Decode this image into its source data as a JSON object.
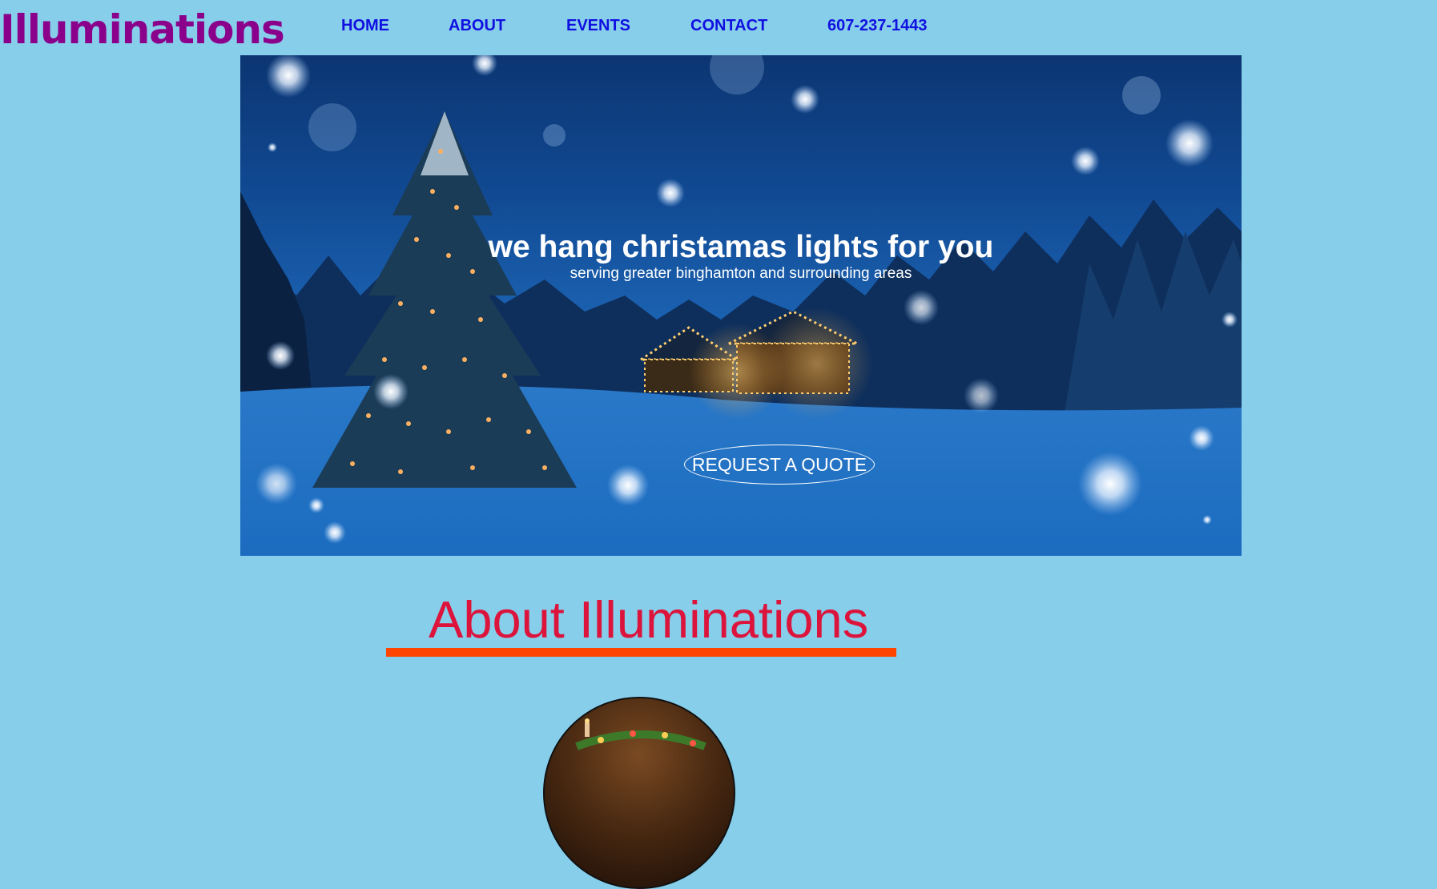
{
  "brand": {
    "logo": "Illuminations"
  },
  "nav": {
    "items": [
      {
        "label": "HOME"
      },
      {
        "label": "ABOUT"
      },
      {
        "label": "EVENTS"
      },
      {
        "label": "CONTACT"
      },
      {
        "label": "607-237-1443"
      }
    ]
  },
  "hero": {
    "title": "we hang christamas lights for you",
    "subtitle": "serving greater binghamton and surrounding areas",
    "cta": "REQUEST A QUOTE"
  },
  "about": {
    "title": "About Illuminations"
  },
  "colors": {
    "background": "#87ceeb",
    "logo": "#8b008b",
    "nav_link": "#1010e0",
    "about_title": "#dc143c",
    "about_underline": "#ff4500"
  }
}
